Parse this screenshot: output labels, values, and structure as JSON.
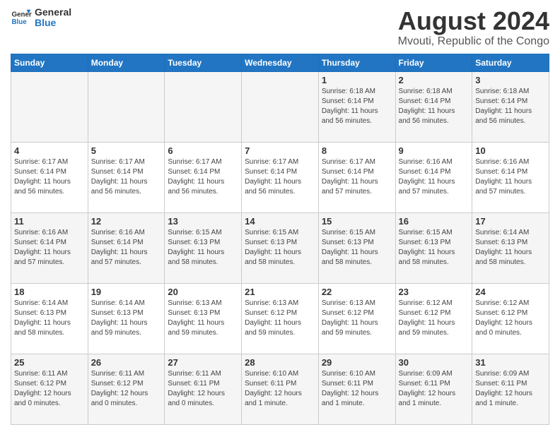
{
  "logo": {
    "line1": "General",
    "line2": "Blue"
  },
  "title": "August 2024",
  "subtitle": "Mvouti, Republic of the Congo",
  "days_of_week": [
    "Sunday",
    "Monday",
    "Tuesday",
    "Wednesday",
    "Thursday",
    "Friday",
    "Saturday"
  ],
  "weeks": [
    [
      {
        "day": "",
        "info": ""
      },
      {
        "day": "",
        "info": ""
      },
      {
        "day": "",
        "info": ""
      },
      {
        "day": "",
        "info": ""
      },
      {
        "day": "1",
        "info": "Sunrise: 6:18 AM\nSunset: 6:14 PM\nDaylight: 11 hours\nand 56 minutes."
      },
      {
        "day": "2",
        "info": "Sunrise: 6:18 AM\nSunset: 6:14 PM\nDaylight: 11 hours\nand 56 minutes."
      },
      {
        "day": "3",
        "info": "Sunrise: 6:18 AM\nSunset: 6:14 PM\nDaylight: 11 hours\nand 56 minutes."
      }
    ],
    [
      {
        "day": "4",
        "info": "Sunrise: 6:17 AM\nSunset: 6:14 PM\nDaylight: 11 hours\nand 56 minutes."
      },
      {
        "day": "5",
        "info": "Sunrise: 6:17 AM\nSunset: 6:14 PM\nDaylight: 11 hours\nand 56 minutes."
      },
      {
        "day": "6",
        "info": "Sunrise: 6:17 AM\nSunset: 6:14 PM\nDaylight: 11 hours\nand 56 minutes."
      },
      {
        "day": "7",
        "info": "Sunrise: 6:17 AM\nSunset: 6:14 PM\nDaylight: 11 hours\nand 56 minutes."
      },
      {
        "day": "8",
        "info": "Sunrise: 6:17 AM\nSunset: 6:14 PM\nDaylight: 11 hours\nand 57 minutes."
      },
      {
        "day": "9",
        "info": "Sunrise: 6:16 AM\nSunset: 6:14 PM\nDaylight: 11 hours\nand 57 minutes."
      },
      {
        "day": "10",
        "info": "Sunrise: 6:16 AM\nSunset: 6:14 PM\nDaylight: 11 hours\nand 57 minutes."
      }
    ],
    [
      {
        "day": "11",
        "info": "Sunrise: 6:16 AM\nSunset: 6:14 PM\nDaylight: 11 hours\nand 57 minutes."
      },
      {
        "day": "12",
        "info": "Sunrise: 6:16 AM\nSunset: 6:14 PM\nDaylight: 11 hours\nand 57 minutes."
      },
      {
        "day": "13",
        "info": "Sunrise: 6:15 AM\nSunset: 6:13 PM\nDaylight: 11 hours\nand 58 minutes."
      },
      {
        "day": "14",
        "info": "Sunrise: 6:15 AM\nSunset: 6:13 PM\nDaylight: 11 hours\nand 58 minutes."
      },
      {
        "day": "15",
        "info": "Sunrise: 6:15 AM\nSunset: 6:13 PM\nDaylight: 11 hours\nand 58 minutes."
      },
      {
        "day": "16",
        "info": "Sunrise: 6:15 AM\nSunset: 6:13 PM\nDaylight: 11 hours\nand 58 minutes."
      },
      {
        "day": "17",
        "info": "Sunrise: 6:14 AM\nSunset: 6:13 PM\nDaylight: 11 hours\nand 58 minutes."
      }
    ],
    [
      {
        "day": "18",
        "info": "Sunrise: 6:14 AM\nSunset: 6:13 PM\nDaylight: 11 hours\nand 58 minutes."
      },
      {
        "day": "19",
        "info": "Sunrise: 6:14 AM\nSunset: 6:13 PM\nDaylight: 11 hours\nand 59 minutes."
      },
      {
        "day": "20",
        "info": "Sunrise: 6:13 AM\nSunset: 6:13 PM\nDaylight: 11 hours\nand 59 minutes."
      },
      {
        "day": "21",
        "info": "Sunrise: 6:13 AM\nSunset: 6:12 PM\nDaylight: 11 hours\nand 59 minutes."
      },
      {
        "day": "22",
        "info": "Sunrise: 6:13 AM\nSunset: 6:12 PM\nDaylight: 11 hours\nand 59 minutes."
      },
      {
        "day": "23",
        "info": "Sunrise: 6:12 AM\nSunset: 6:12 PM\nDaylight: 11 hours\nand 59 minutes."
      },
      {
        "day": "24",
        "info": "Sunrise: 6:12 AM\nSunset: 6:12 PM\nDaylight: 12 hours\nand 0 minutes."
      }
    ],
    [
      {
        "day": "25",
        "info": "Sunrise: 6:11 AM\nSunset: 6:12 PM\nDaylight: 12 hours\nand 0 minutes."
      },
      {
        "day": "26",
        "info": "Sunrise: 6:11 AM\nSunset: 6:12 PM\nDaylight: 12 hours\nand 0 minutes."
      },
      {
        "day": "27",
        "info": "Sunrise: 6:11 AM\nSunset: 6:11 PM\nDaylight: 12 hours\nand 0 minutes."
      },
      {
        "day": "28",
        "info": "Sunrise: 6:10 AM\nSunset: 6:11 PM\nDaylight: 12 hours\nand 1 minute."
      },
      {
        "day": "29",
        "info": "Sunrise: 6:10 AM\nSunset: 6:11 PM\nDaylight: 12 hours\nand 1 minute."
      },
      {
        "day": "30",
        "info": "Sunrise: 6:09 AM\nSunset: 6:11 PM\nDaylight: 12 hours\nand 1 minute."
      },
      {
        "day": "31",
        "info": "Sunrise: 6:09 AM\nSunset: 6:11 PM\nDaylight: 12 hours\nand 1 minute."
      }
    ]
  ]
}
